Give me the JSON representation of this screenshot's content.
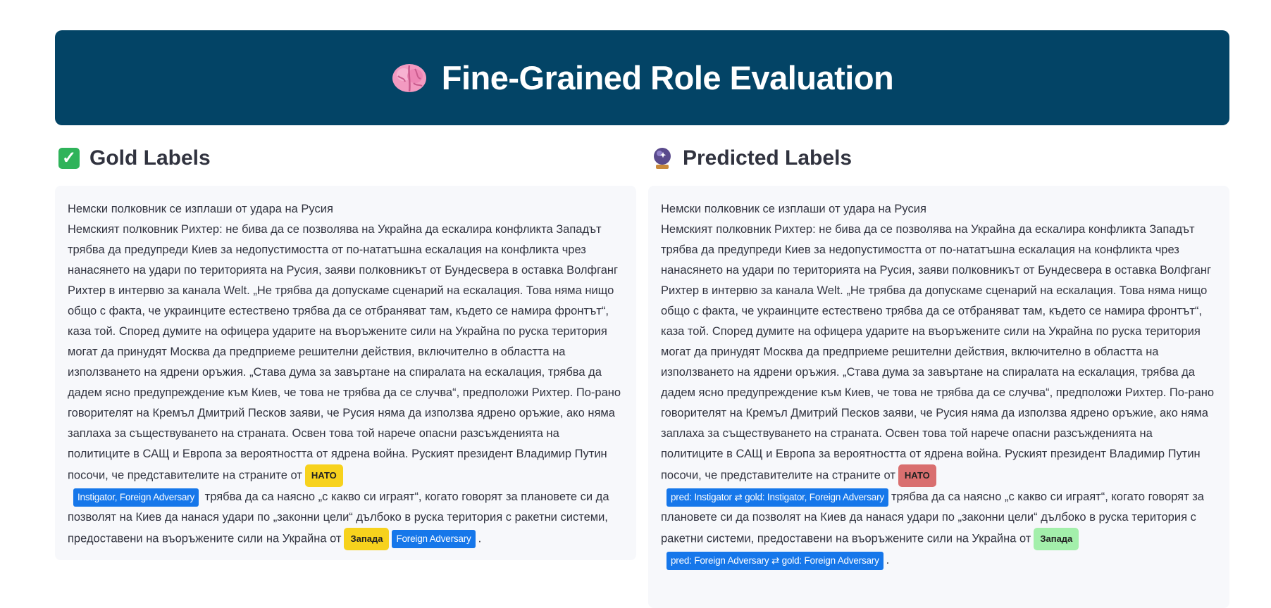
{
  "banner": {
    "title": "Fine-Grained Role Evaluation"
  },
  "gold": {
    "heading": "Gold Labels",
    "title_line": "Немски полковник се изплаши от удара на Русия",
    "text_before": "Немският полковник Рихтер: не бива да се позволява на Украйна да ескалира конфликта Западът трябва да предупреди Киев за недопустимостта от по-нататъшна ескалация на конфликта чрез нанасянето на удари по територията на Русия, заяви полковникът от Бундесвера в оставка Волфганг Рихтер в интервю за канала Welt. „Не трябва да допускаме сценарий на ескалация. Това няма нищо общо с факта, че украинците естествено трябва да се отбраняват там, където се намира фронтът“, каза той. Според думите на офицера ударите на въоръжените сили на Украйна по руска територия могат да принудят Москва да предприеме решителни действия, включително в областта на използването на ядрени оръжия. „Става дума за завъртане на спиралата на ескалация, трябва да дадем ясно предупреждение към Киев, че това не трябва да се случва“, предположи Рихтер. По-рано говорителят на Кремъл Дмитрий Песков заяви, че Русия няма да използва ядрено оръжие, ако няма заплаха за съществуването на страната. Освен това той нарече опасни разсъжденията на политиците в САЩ и Европа за вероятността от ядрена война. Руският президент Владимир Путин посочи, че представителите на страните от",
    "entity1": "НАТО",
    "role1": "Instigator, Foreign Adversary",
    "text_middle": "трябва да са наясно „с какво си играят“, когато говорят за плановете си да позволят на Киев да нанася удари по „законни цели“ дълбоко в руска територия с ракетни системи, предоставени на въоръжените сили на Украйна от",
    "entity2": "Запада",
    "role2": "Foreign Adversary",
    "text_end": "."
  },
  "pred": {
    "heading": "Predicted Labels",
    "title_line": "Немски полковник се изплаши от удара на Русия",
    "text_before": "Немският полковник Рихтер: не бива да се позволява на Украйна да ескалира конфликта Западът трябва да предупреди Киев за недопустимостта от по-нататъшна ескалация на конфликта чрез нанасянето на удари по територията на Русия, заяви полковникът от Бундесвера в оставка Волфганг Рихтер в интервю за канала Welt. „Не трябва да допускаме сценарий на ескалация. Това няма нищо общо с факта, че украинците естествено трябва да се отбраняват там, където се намира фронтът“, каза той. Според думите на офицера ударите на въоръжените сили на Украйна по руска територия могат да принудят Москва да предприеме решителни действия, включително в областта на използването на ядрени оръжия. „Става дума за завъртане на спиралата на ескалация, трябва да дадем ясно предупреждение към Киев, че това не трябва да се случва“, предположи Рихтер. По-рано говорителят на Кремъл Дмитрий Песков заяви, че Русия няма да използва ядрено оръжие, ако няма заплаха за съществуването на страната. Освен това той нарече опасни разсъжденията на политиците в САЩ и Европа за вероятността от ядрена война. Руският президент Владимир Путин посочи, че представителите на страните от",
    "entity1": "НАТО",
    "role1": "pred: Instigator ⇄ gold: Instigator, Foreign Adversary",
    "text_middle": "трябва да са наясно „с какво си играят“, когато говорят за плановете си да позволят на Киев да нанася удари по „законни цели“ дълбоко в руска територия с ракетни системи, предоставени на въоръжените сили на Украйна от",
    "entity2": "Запада",
    "role2": "pred: Foreign Adversary ⇄ gold: Foreign Adversary",
    "text_end": "."
  },
  "colors": {
    "banner": "#034466",
    "entity_match": "#f7d21d",
    "entity_partial": "#d96f6f",
    "entity_exact": "#a3efab",
    "role_tag": "#1677ea"
  }
}
